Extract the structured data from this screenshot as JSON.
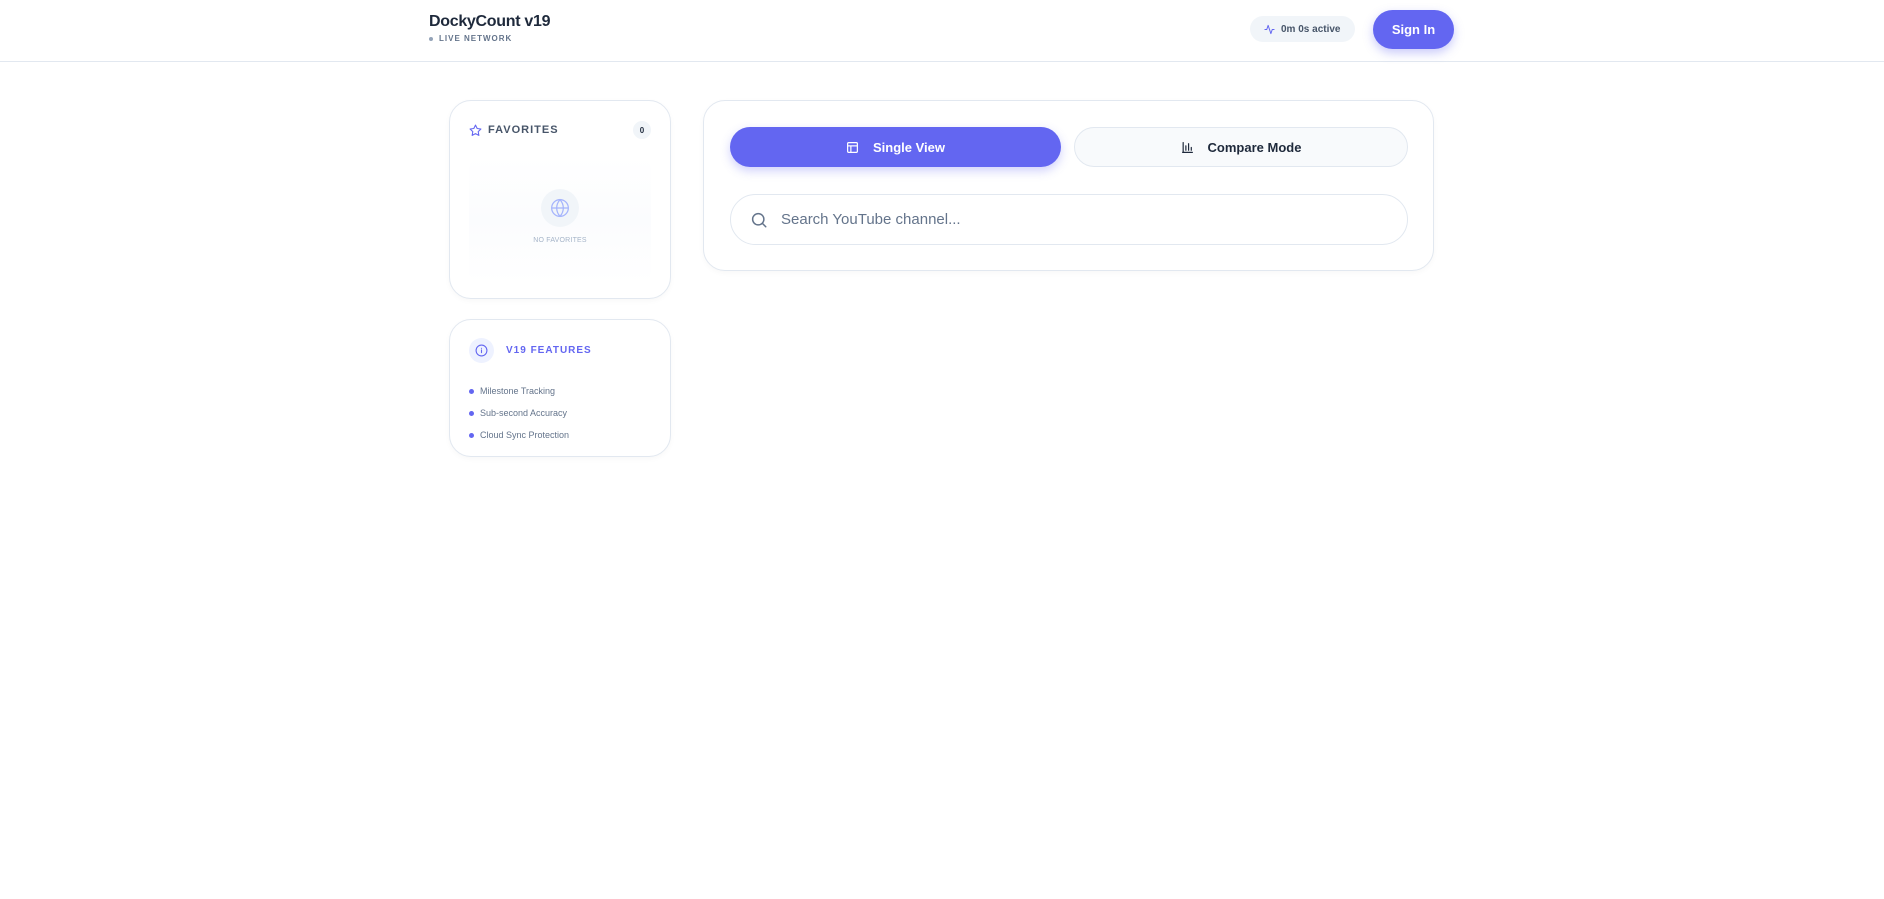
{
  "header": {
    "brand_title": "DockyCount v19",
    "brand_subtitle": "LIVE NETWORK",
    "activity_text": "0m 0s active",
    "signin_label": "Sign In"
  },
  "favorites": {
    "title": "FAVORITES",
    "count": "0",
    "empty_text": "NO FAVORITES"
  },
  "features": {
    "title": "V19 FEATURES",
    "items": [
      "Milestone Tracking",
      "Sub-second Accuracy",
      "Cloud Sync Protection"
    ]
  },
  "main": {
    "single_view_label": "Single View",
    "compare_mode_label": "Compare Mode",
    "search_placeholder": "Search YouTube channel...",
    "search_value": ""
  },
  "colors": {
    "accent": "#6366f1",
    "text_dark": "#1e293b",
    "text_muted": "#64748b",
    "border": "#e2e8f0"
  },
  "icons": {
    "activity": "activity-icon",
    "favorites": "star-icon",
    "empty": "globe-icon",
    "features": "info-icon",
    "single_view": "layout-icon",
    "compare_mode": "bar-chart-icon",
    "search": "search-icon"
  }
}
